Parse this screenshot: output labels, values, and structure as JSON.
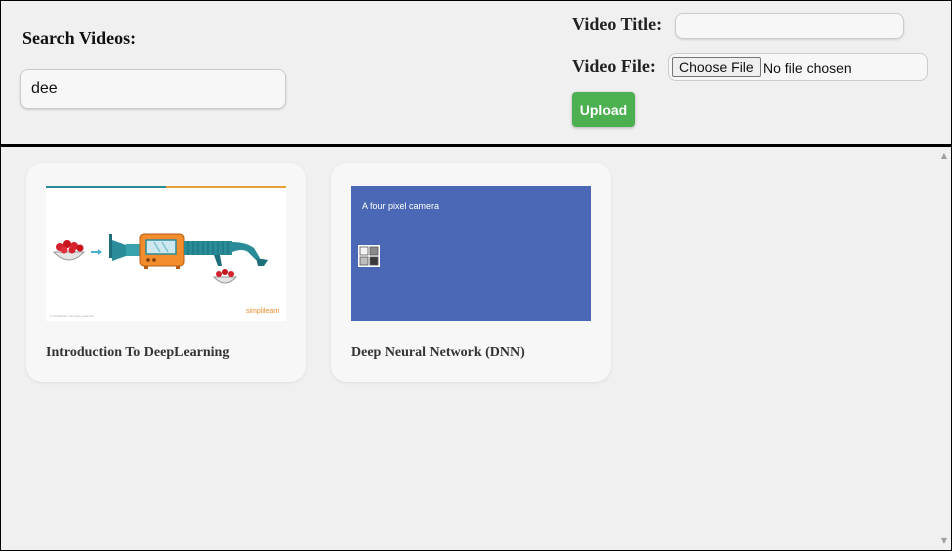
{
  "search": {
    "label": "Search Videos:",
    "value": "dee"
  },
  "upload_form": {
    "title_label": "Video Title:",
    "title_value": "",
    "file_label": "Video File:",
    "choose_file_label": "Choose File",
    "file_status": "No file chosen",
    "upload_button": "Upload"
  },
  "videos": [
    {
      "title": "Introduction To DeepLearning"
    },
    {
      "title": "Deep Neural Network (DNN)",
      "thumbnail_caption": "A four pixel camera"
    }
  ],
  "thumb1": {
    "brand_text": "simplilearn",
    "footer_text": "© Simplilearn. All rights reserved."
  },
  "colors": {
    "accent_green": "#4caf50",
    "thumb_blue": "#4a68b5",
    "thumb_teal": "#2a8c99",
    "thumb_orange": "#f28c2c"
  },
  "scroll": {
    "up_icon": "scroll-up-arrow",
    "down_icon": "scroll-down-arrow"
  }
}
